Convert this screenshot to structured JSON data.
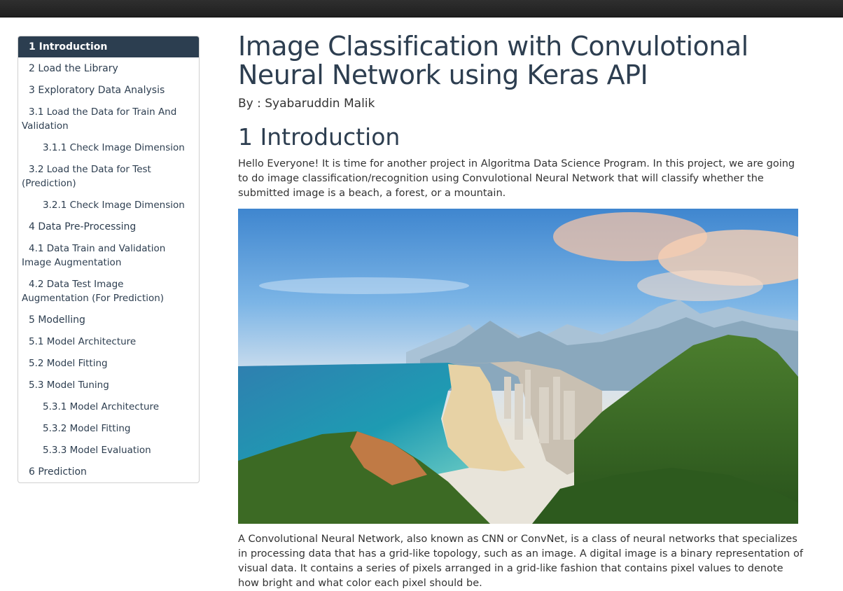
{
  "toc": {
    "items": [
      {
        "label": "1 Introduction",
        "level": 1,
        "active": true
      },
      {
        "label": "2 Load the Library",
        "level": 1
      },
      {
        "label": "3 Exploratory Data Analysis",
        "level": 1
      },
      {
        "label": "3.1 Load the Data for Train And Validation",
        "level": 2
      },
      {
        "label": "3.1.1 Check Image Dimension",
        "level": 3
      },
      {
        "label": "3.2 Load the Data for Test (Prediction)",
        "level": 2
      },
      {
        "label": "3.2.1 Check Image Dimension",
        "level": 3
      },
      {
        "label": "4 Data Pre-Processing",
        "level": 1
      },
      {
        "label": "4.1 Data Train and Validation Image Augmentation",
        "level": 2
      },
      {
        "label": "4.2 Data Test Image Augmentation (For Prediction)",
        "level": 2
      },
      {
        "label": "5 Modelling",
        "level": 1
      },
      {
        "label": "5.1 Model Architecture",
        "level": 2
      },
      {
        "label": "5.2 Model Fitting",
        "level": 2
      },
      {
        "label": "5.3 Model Tuning",
        "level": 2
      },
      {
        "label": "5.3.1 Model Architecture",
        "level": 3
      },
      {
        "label": "5.3.2 Model Fitting",
        "level": 3
      },
      {
        "label": "5.3.3 Model Evaluation",
        "level": 3
      },
      {
        "label": "6 Prediction",
        "level": 1
      }
    ]
  },
  "document": {
    "title": "Image Classification with Convulotional Neural Network using Keras API",
    "author": "By : Syabaruddin Malik",
    "section_heading": "1 Introduction",
    "intro_paragraph": "Hello Everyone! It is time for another project in Algoritma Data Science Program. In this project, we are going to do image classification/recognition using Convulotional Neural Network that will classify whether the submitted image is a beach, a forest, or a mountain.",
    "cnn_paragraph": "A Convolutional Neural Network, also known as CNN or ConvNet, is a class of neural networks that specializes in processing data that has a grid-like topology, such as an image. A digital image is a binary representation of visual data. It contains a series of pixels arranged in a grid-like fashion that contains pixel values to denote how bright and what color each pixel should be."
  },
  "colors": {
    "accent": "#2c3e50",
    "topbar": "#222222"
  }
}
